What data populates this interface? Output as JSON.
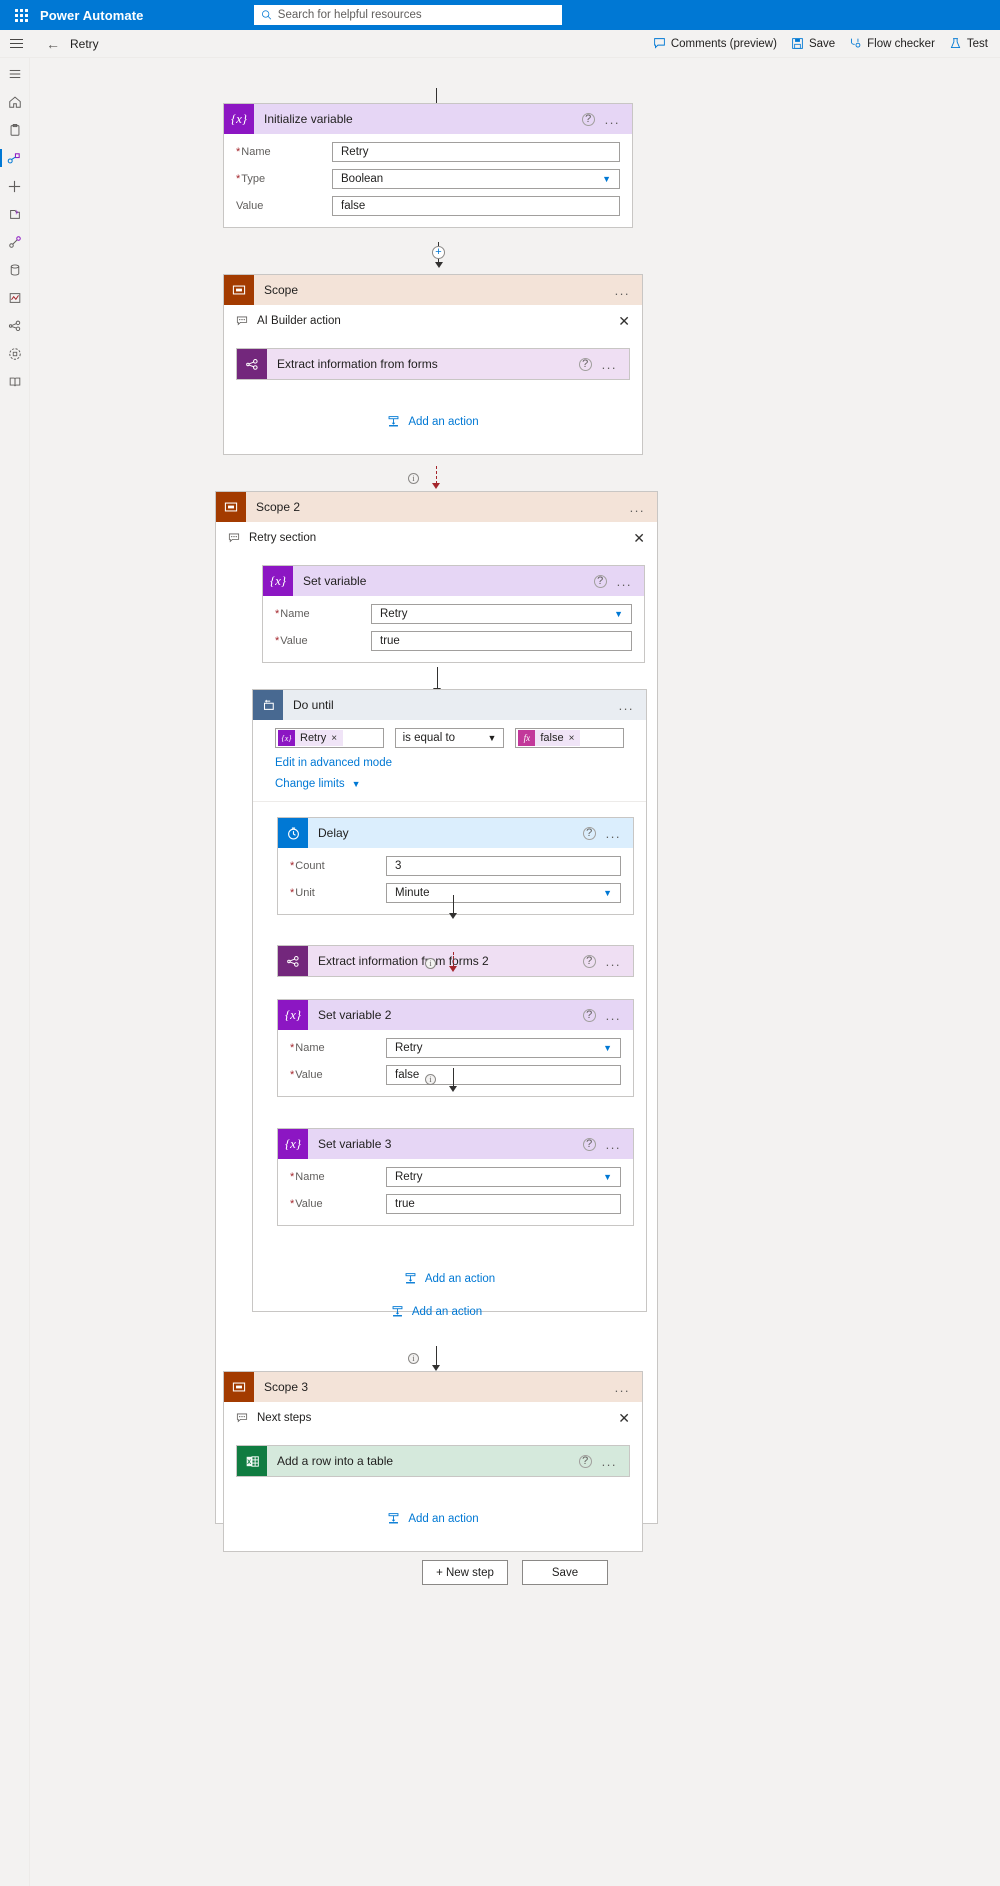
{
  "suitebar": {
    "waffle_label": "App launcher",
    "brand": "Power Automate",
    "search_placeholder": "Search for helpful resources"
  },
  "commandbar": {
    "flow_name": "Retry",
    "back_label": "Back",
    "buttons": [
      {
        "label": "Comments (preview)",
        "icon": "comment-icon"
      },
      {
        "label": "Save",
        "icon": "save-icon"
      },
      {
        "label": "Flow checker",
        "icon": "flow-checker-icon"
      },
      {
        "label": "Test",
        "icon": "test-flask-icon"
      }
    ]
  },
  "rail": {
    "items": [
      {
        "icon": "hamburger-menu-icon",
        "selected": false
      },
      {
        "icon": "home-icon",
        "selected": false
      },
      {
        "icon": "clipboard-approvals-icon",
        "selected": false
      },
      {
        "icon": "flows-icon",
        "selected": true
      },
      {
        "icon": "create-plus-icon",
        "selected": false
      },
      {
        "icon": "templates-icon",
        "selected": false
      },
      {
        "icon": "connectors-icon",
        "selected": false
      },
      {
        "icon": "data-icon",
        "selected": false
      },
      {
        "icon": "monitor-icon",
        "selected": false
      },
      {
        "icon": "ai-builder-icon",
        "selected": false
      },
      {
        "icon": "process-advisor-icon",
        "selected": false
      },
      {
        "icon": "learn-icon",
        "selected": false
      }
    ]
  },
  "flow": {
    "initialize_variable": {
      "title": "Initialize variable",
      "icon": "variable-icon",
      "help_label": "?",
      "menu_label": "...",
      "fields": [
        {
          "label": "Name",
          "required": true,
          "value": "Retry",
          "type": "text"
        },
        {
          "label": "Type",
          "required": true,
          "value": "Boolean",
          "type": "select"
        },
        {
          "label": "Value",
          "required": false,
          "value": "false",
          "type": "text"
        }
      ]
    },
    "insert_node_label": "+",
    "scope1": {
      "title": "Scope",
      "icon": "scope-icon",
      "menu_label": "...",
      "note": "AI Builder action",
      "note_icon": "comment-icon",
      "close_label": "✕",
      "actions": [
        {
          "title": "Extract information from forms",
          "icon": "ai-builder-icon",
          "help_label": "?",
          "menu_label": "..."
        }
      ],
      "add_action_label": "Add an action"
    },
    "scope2": {
      "title": "Scope 2",
      "icon": "scope-icon",
      "menu_label": "...",
      "note": "Retry section",
      "note_icon": "comment-icon",
      "close_label": "✕",
      "set_variable": {
        "title": "Set variable",
        "icon": "variable-icon",
        "help_label": "?",
        "menu_label": "...",
        "fields": [
          {
            "label": "Name",
            "required": true,
            "value": "Retry",
            "type": "select"
          },
          {
            "label": "Value",
            "required": true,
            "value": "true",
            "type": "text"
          }
        ]
      },
      "do_until": {
        "title": "Do until",
        "icon": "do-until-icon",
        "menu_label": "...",
        "condition": {
          "left_token": "Retry",
          "left_token_icon": "variable-icon",
          "left_token_remove": "×",
          "operator": "is equal to",
          "right_token": "false",
          "right_token_icon": "expression-fx-icon",
          "right_token_remove": "×"
        },
        "advanced_link": "Edit in advanced mode",
        "change_limits_link": "Change limits",
        "delay": {
          "title": "Delay",
          "icon": "clock-icon",
          "help_label": "?",
          "menu_label": "...",
          "fields": [
            {
              "label": "Count",
              "required": true,
              "value": "3",
              "type": "text"
            },
            {
              "label": "Unit",
              "required": true,
              "value": "Minute",
              "type": "select"
            }
          ]
        },
        "extract2": {
          "title": "Extract information from forms 2",
          "icon": "ai-builder-icon",
          "help_label": "?",
          "menu_label": "..."
        },
        "set_variable2": {
          "title": "Set variable 2",
          "icon": "variable-icon",
          "help_label": "?",
          "menu_label": "...",
          "fields": [
            {
              "label": "Name",
              "required": true,
              "value": "Retry",
              "type": "select"
            },
            {
              "label": "Value",
              "required": true,
              "value": "false",
              "type": "text"
            }
          ]
        },
        "set_variable3": {
          "title": "Set variable 3",
          "icon": "variable-icon",
          "help_label": "?",
          "menu_label": "...",
          "fields": [
            {
              "label": "Name",
              "required": true,
              "value": "Retry",
              "type": "select"
            },
            {
              "label": "Value",
              "required": true,
              "value": "true",
              "type": "text"
            }
          ]
        },
        "add_action_label": "Add an action"
      },
      "add_action_label": "Add an action"
    },
    "scope3": {
      "title": "Scope 3",
      "icon": "scope-icon",
      "menu_label": "...",
      "note": "Next steps",
      "note_icon": "comment-icon",
      "close_label": "✕",
      "actions": [
        {
          "title": "Add a row into a table",
          "icon": "excel-icon",
          "help_label": "?",
          "menu_label": "..."
        }
      ],
      "add_action_label": "Add an action"
    }
  },
  "footer": {
    "new_step_label": "+ New step",
    "save_label": "Save"
  },
  "colors": {
    "brand_blue": "#0078d4",
    "variable_purple": "#8c16c3",
    "scope_orange": "#a33b00",
    "ai_purple": "#73277c",
    "excel_green": "#107c41",
    "error_red": "#a4262c"
  }
}
